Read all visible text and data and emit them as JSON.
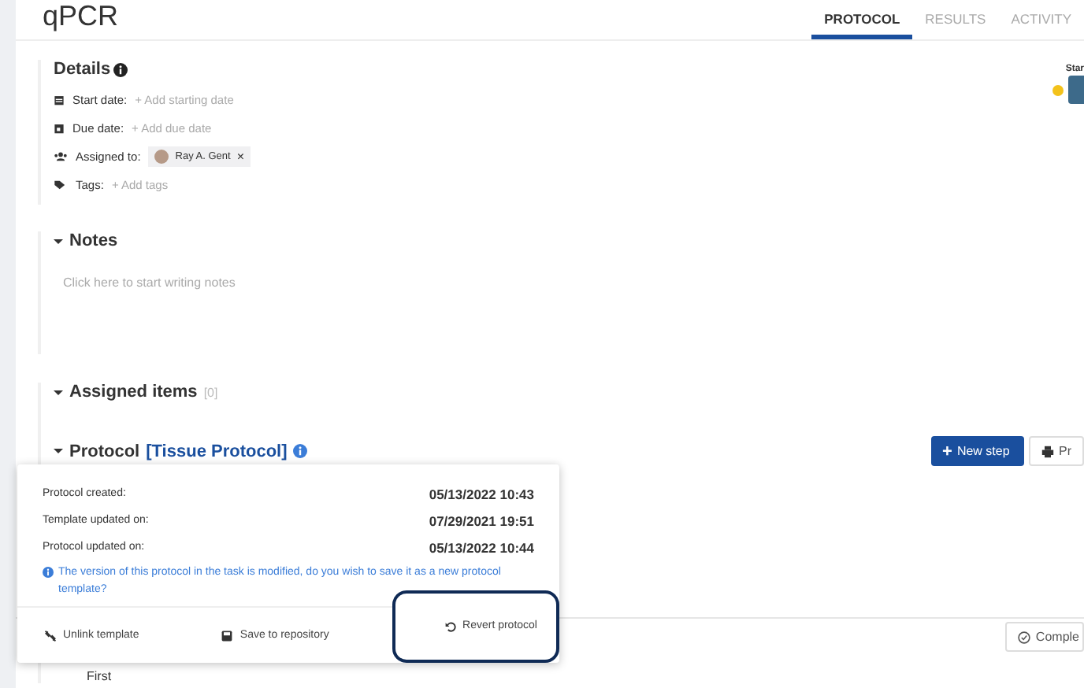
{
  "header": {
    "title": "qPCR",
    "tabs": [
      {
        "label": "PROTOCOL",
        "selected": true
      },
      {
        "label": "RESULTS",
        "selected": false
      },
      {
        "label": "ACTIVITY",
        "selected": false
      }
    ]
  },
  "details": {
    "title": "Details",
    "fields": [
      {
        "kind": "date",
        "label": "Start date:",
        "value": "+ Add starting date"
      },
      {
        "kind": "due",
        "label": "Due date:",
        "value": "+ Add due date"
      },
      {
        "kind": "users",
        "label": "Assigned to:",
        "chip": "Ray A. Gent",
        "chip_close": "×"
      },
      {
        "kind": "tags",
        "label": "Tags:",
        "value": "+ Add tags"
      }
    ]
  },
  "status": {
    "label": "Star"
  },
  "notes": {
    "title": "Notes",
    "placeholder": "Click here to start writing notes"
  },
  "assigned": {
    "title": "Assigned items",
    "count": "[0]"
  },
  "protocol": {
    "title": "Protocol",
    "template": "[Tissue Protocol]",
    "buttons": [
      {
        "kind": "primary",
        "icon": "+",
        "label": "New step"
      },
      {
        "kind": "print",
        "label": "Pr"
      }
    ],
    "complete": "Comple",
    "step": "First"
  },
  "popup": {
    "rows": [
      {
        "label": "Protocol created:",
        "value": "05/13/2022 10:43"
      },
      {
        "label": "Template updated on:",
        "value": "07/29/2021 19:51"
      },
      {
        "label": "Protocol updated on:",
        "value": "05/13/2022 10:44"
      }
    ],
    "notice": "The version of this protocol in the task is modified, do you wish to save it as a new protocol template?",
    "actions": [
      {
        "kind": "unlink",
        "label": "Unlink template",
        "highlighted": false
      },
      {
        "kind": "save",
        "label": "Save to repository",
        "highlighted": false
      },
      {
        "kind": "revert",
        "label": "Revert protocol",
        "highlighted": true
      }
    ]
  }
}
